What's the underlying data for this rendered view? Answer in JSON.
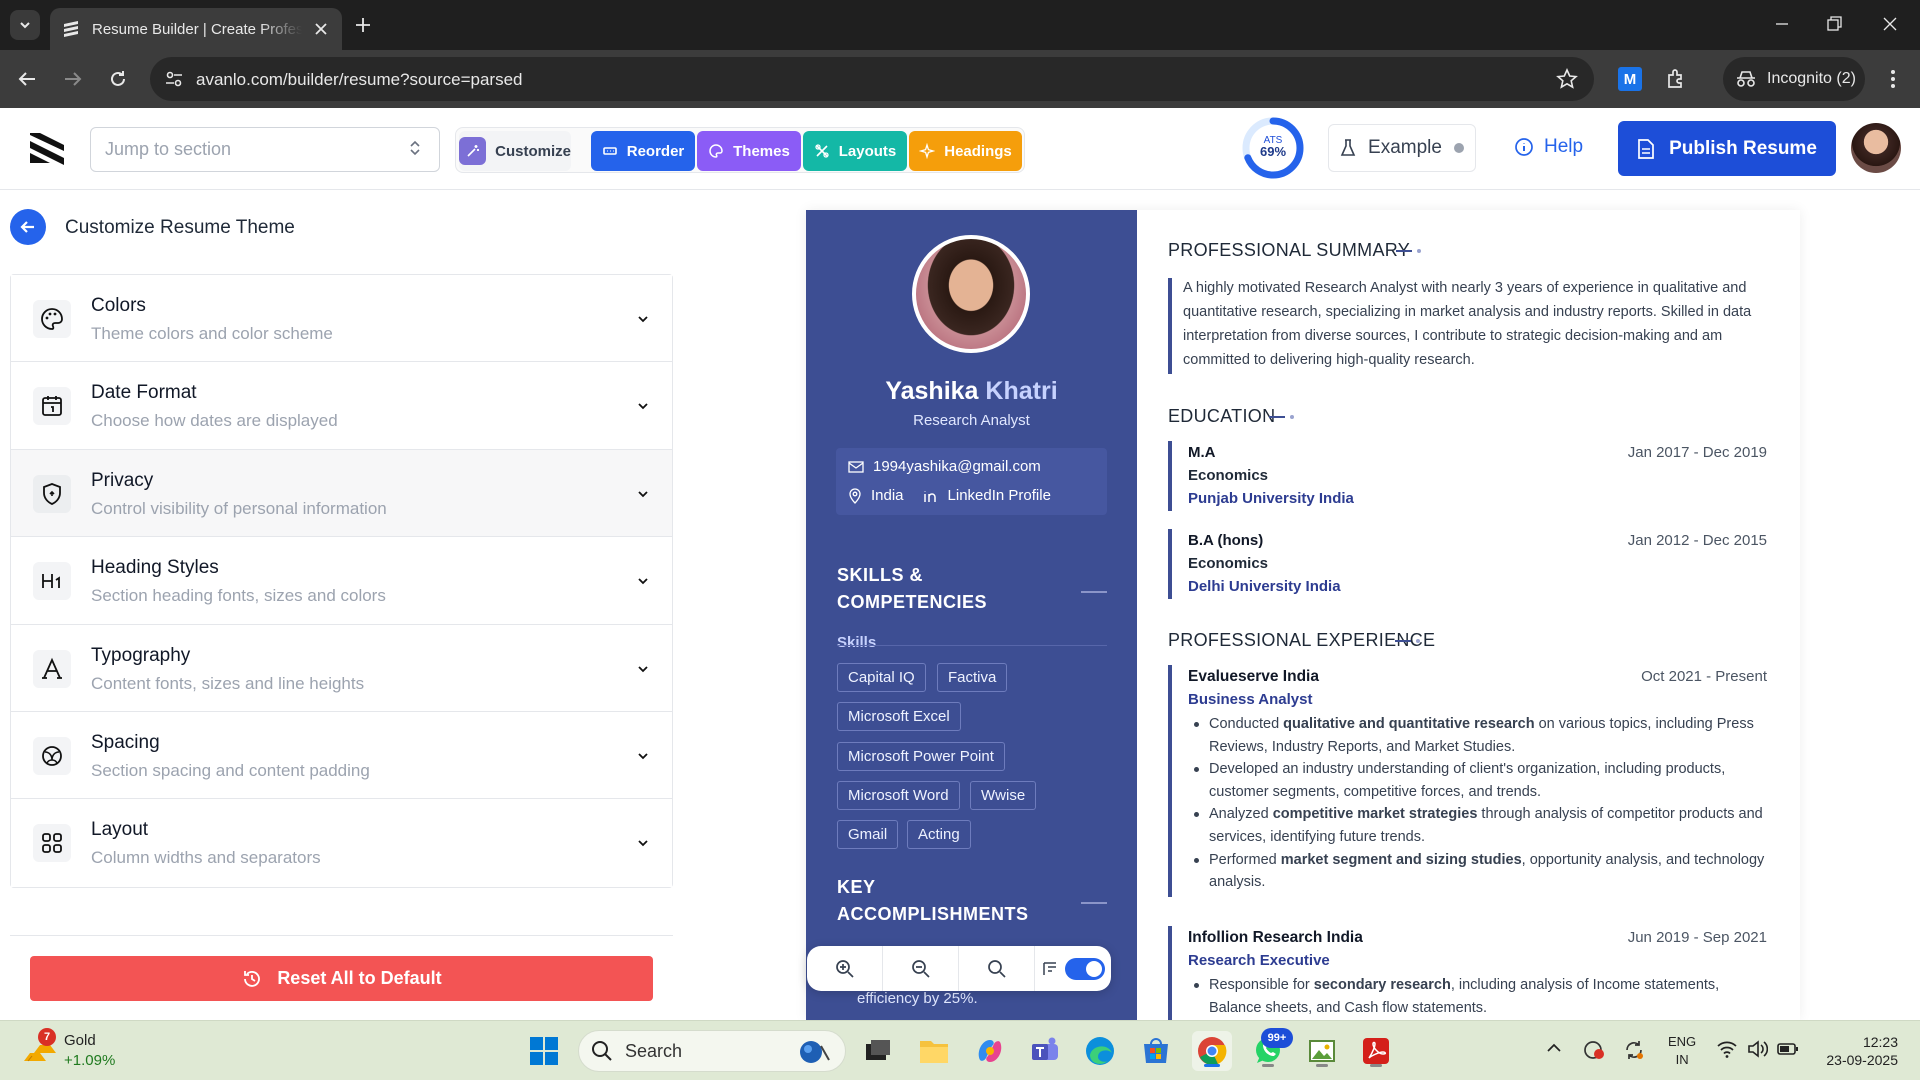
{
  "browser": {
    "tab_title": "Resume Builder | Create Professional Resumes",
    "url": "avanlo.com/builder/resume?source=parsed",
    "incognito_label": "Incognito (2)"
  },
  "header": {
    "jump_placeholder": "Jump to section",
    "buttons": [
      {
        "label": "Customize",
        "color": "#f3f4f6"
      },
      {
        "label": "Reorder",
        "color": "#2563eb"
      },
      {
        "label": "Themes",
        "color": "#8b5cf6"
      },
      {
        "label": "Layouts",
        "color": "#14b8a6"
      },
      {
        "label": "Headings",
        "color": "#f59e0b"
      }
    ],
    "ats_label": "ATS",
    "ats_value": "69%",
    "ats_fraction": 0.69,
    "example_label": "Example",
    "help_label": "Help",
    "publish_label": "Publish Resume"
  },
  "panel": {
    "title": "Customize Resume Theme",
    "items": [
      {
        "title": "Colors",
        "subtitle": "Theme colors and color scheme",
        "icon": "palette-icon"
      },
      {
        "title": "Date Format",
        "subtitle": "Choose how dates are displayed",
        "icon": "calendar-icon"
      },
      {
        "title": "Privacy",
        "subtitle": "Control visibility of personal information",
        "icon": "shield-icon"
      },
      {
        "title": "Heading Styles",
        "subtitle": "Section heading fonts, sizes and colors",
        "icon": "heading-icon"
      },
      {
        "title": "Typography",
        "subtitle": "Content fonts, sizes and line heights",
        "icon": "typography-icon"
      },
      {
        "title": "Spacing",
        "subtitle": "Section spacing and content padding",
        "icon": "spacing-icon"
      },
      {
        "title": "Layout",
        "subtitle": "Column widths and separators",
        "icon": "grid-icon"
      }
    ],
    "reset_label": "Reset All to Default"
  },
  "resume": {
    "first_name": "Yashika",
    "last_name": "Khatri",
    "role": "Research Analyst",
    "email": "1994yashika@gmail.com",
    "location": "India",
    "linkedin": "LinkedIn Profile",
    "skills_heading_1": "SKILLS &",
    "skills_heading_2": "COMPETENCIES",
    "skills_sub": "Skills",
    "skills": [
      "Capital IQ",
      "Factiva",
      "Microsoft Excel",
      "Microsoft Power Point",
      "Microsoft Word",
      "Wwise",
      "Gmail",
      "Acting"
    ],
    "accomplishments_heading_1": "KEY",
    "accomplishments_heading_2": "ACCOMPLISHMENTS",
    "accomplishment_fragment": "efficiency by 25%.",
    "summary_heading": "PROFESSIONAL SUMMARY",
    "summary": "A highly motivated Research Analyst with nearly 3 years of experience in qualitative and quantitative research, specializing in market analysis and industry reports. Skilled in data interpretation from diverse sources, I contribute to strategic decision-making and am committed to delivering high-quality research.",
    "education_heading": "EDUCATION",
    "education": [
      {
        "degree": "M.A",
        "field": "Economics",
        "school": "Punjab University India",
        "dates": "Jan 2017 - Dec 2019"
      },
      {
        "degree": "B.A (hons)",
        "field": "Economics",
        "school": "Delhi University India",
        "dates": "Jan 2012 - Dec 2015"
      }
    ],
    "experience_heading": "PROFESSIONAL EXPERIENCE",
    "experience": [
      {
        "company": "Evalueserve India",
        "title": "Business Analyst",
        "dates": "Oct 2021 - Present",
        "bullets": [
          [
            "Conducted ",
            "qualitative and quantitative research",
            " on various topics, including Press Reviews, Industry Reports, and Market Studies."
          ],
          [
            "Developed an industry understanding of client's organization, including products, customer segments, competitive forces, and trends.",
            "",
            ""
          ],
          [
            "Analyzed ",
            "competitive market strategies",
            " through analysis of competitor products and services, identifying future trends."
          ],
          [
            "Performed ",
            "market segment and sizing studies",
            ", opportunity analysis, and technology analysis."
          ]
        ]
      },
      {
        "company": "Infollion Research India",
        "title": "Research Executive",
        "dates": "Jun 2019 - Sep 2021",
        "bullets": [
          [
            "Responsible for ",
            "secondary research",
            ", including analysis of Income statements, Balance sheets, and Cash flow statements."
          ]
        ]
      }
    ]
  },
  "taskbar": {
    "stock_name": "Gold",
    "stock_change": "+1.09%",
    "stock_badge": "7",
    "search_label": "Search",
    "whatsapp_badge": "99+",
    "lang_1": "ENG",
    "lang_2": "IN",
    "time": "12:23",
    "date": "23-09-2025"
  },
  "colors": {
    "accent": "#1d4ed8",
    "resume_sidebar": "#3d4e93",
    "reset": "#f35454"
  }
}
